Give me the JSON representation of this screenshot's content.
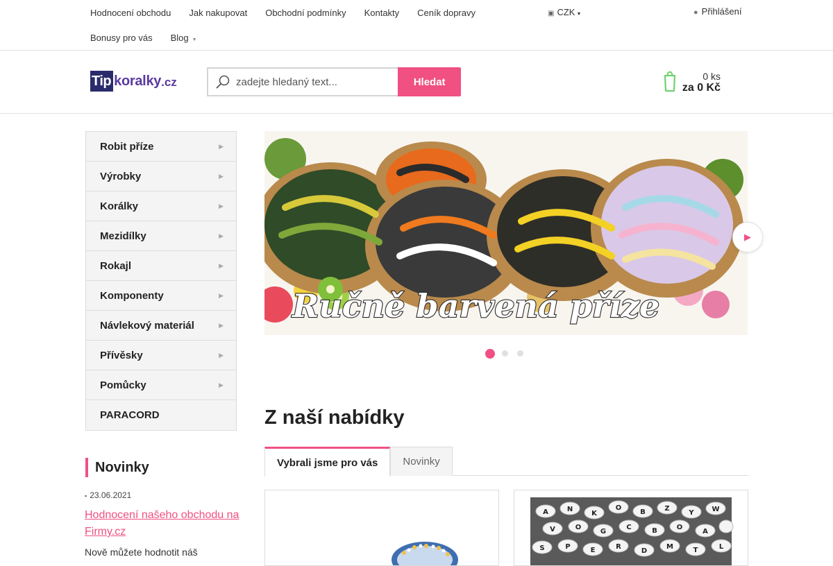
{
  "topnav": {
    "row1": [
      "Hodnocení obchodu",
      "Jak nakupovat",
      "Obchodní podmínky",
      "Kontakty",
      "Ceník dopravy"
    ],
    "row2": [
      "Bonusy pro vás",
      "Blog"
    ]
  },
  "currency": {
    "label": "CZK",
    "icon": "currency-icon"
  },
  "login": {
    "label": "Přihlášení",
    "icon": "user-icon"
  },
  "logo": {
    "part1": "Tip",
    "part2": "koralky",
    "part3": ".cz"
  },
  "search": {
    "placeholder": "zadejte hledaný text...",
    "button": "Hledat",
    "icon": "search-icon"
  },
  "cart": {
    "qty": "0 ks",
    "total": "za 0 Kč",
    "icon": "shopping-bag-icon",
    "color": "#6fd16f"
  },
  "categories": [
    "Robit příze",
    "Výrobky",
    "Korálky",
    "Mezidílky",
    "Rokajl",
    "Komponenty",
    "Návlekový materiál",
    "Přívěsky",
    "Pomůcky",
    "PARACORD"
  ],
  "news": {
    "title": "Novinky",
    "date": "23.06.2021",
    "link": "Hodnocení našeho obchodu na Firmy.cz",
    "text": "Nově můžete hodnotit náš"
  },
  "slider": {
    "caption": "Ručně barvená příze",
    "slides": 3,
    "active": 1
  },
  "offers": {
    "title": "Z naší nabídky",
    "tabs": [
      "Vybrali jsme pro vás",
      "Novinky"
    ]
  },
  "colors": {
    "accent": "#f05082",
    "logo_dark": "#2a2b6b",
    "logo_purple": "#5a3aa0"
  }
}
